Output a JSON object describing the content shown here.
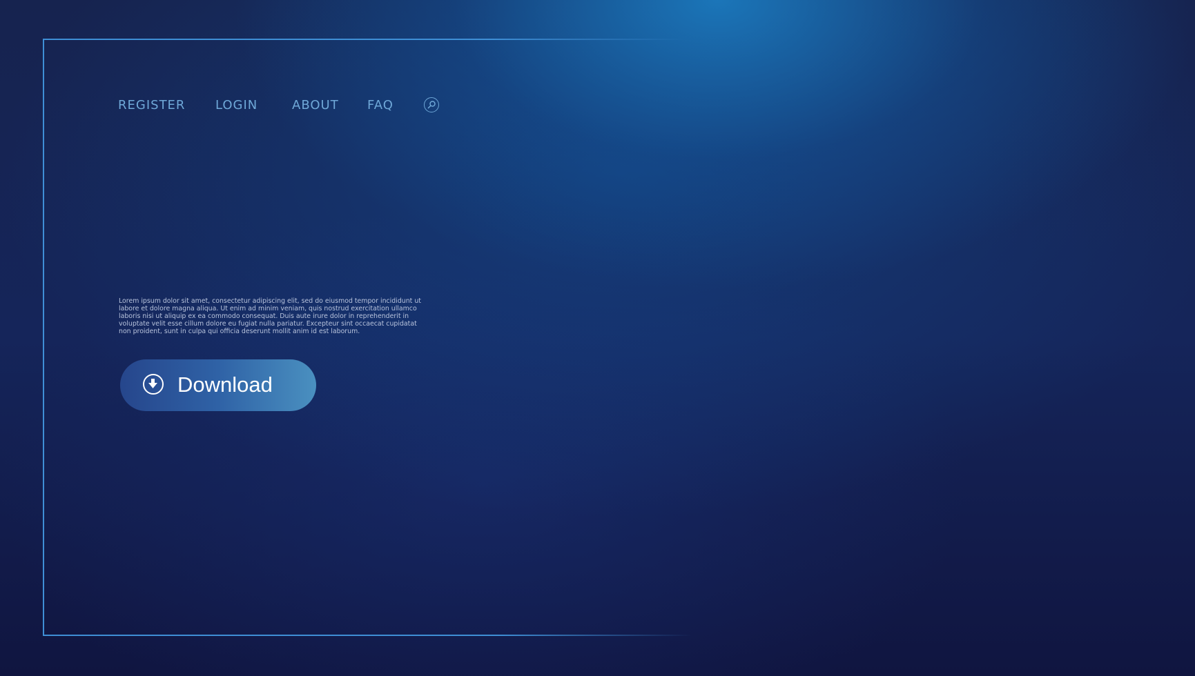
{
  "nav": {
    "items": [
      {
        "label": "REGISTER"
      },
      {
        "label": "LOGIN"
      },
      {
        "label": "ABOUT"
      },
      {
        "label": "FAQ"
      }
    ],
    "search_icon": "search-icon"
  },
  "hero": {
    "body_text": "Lorem ipsum dolor sit amet, consectetur adipiscing elit, sed do eiusmod tempor incididunt ut labore et dolore magna aliqua. Ut enim ad minim veniam, quis nostrud exercitation ullamco laboris nisi ut aliquip ex ea commodo consequat. Duis aute irure dolor in reprehenderit in voluptate velit esse cillum dolore eu fugiat nulla pariatur. Excepteur sint occaecat cupidatat non proident, sunt in culpa qui officia deserunt mollit anim id est laborum.",
    "download_label": "Download",
    "download_icon": "download-circle-icon"
  },
  "colors": {
    "accent": "#3f8fd6",
    "nav_text": "#6fa8d8",
    "background": "#15255a"
  }
}
